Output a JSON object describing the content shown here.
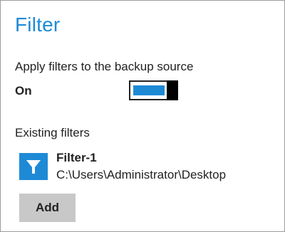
{
  "page": {
    "title": "Filter"
  },
  "apply_filters": {
    "label": "Apply filters to the backup source",
    "state_label": "On",
    "enabled": true,
    "accent_color": "#1e8ad6"
  },
  "existing_filters": {
    "label": "Existing filters",
    "items": [
      {
        "icon": "funnel-icon",
        "name": "Filter-1",
        "path": "C:\\Users\\Administrator\\Desktop"
      }
    ]
  },
  "actions": {
    "add_label": "Add"
  }
}
